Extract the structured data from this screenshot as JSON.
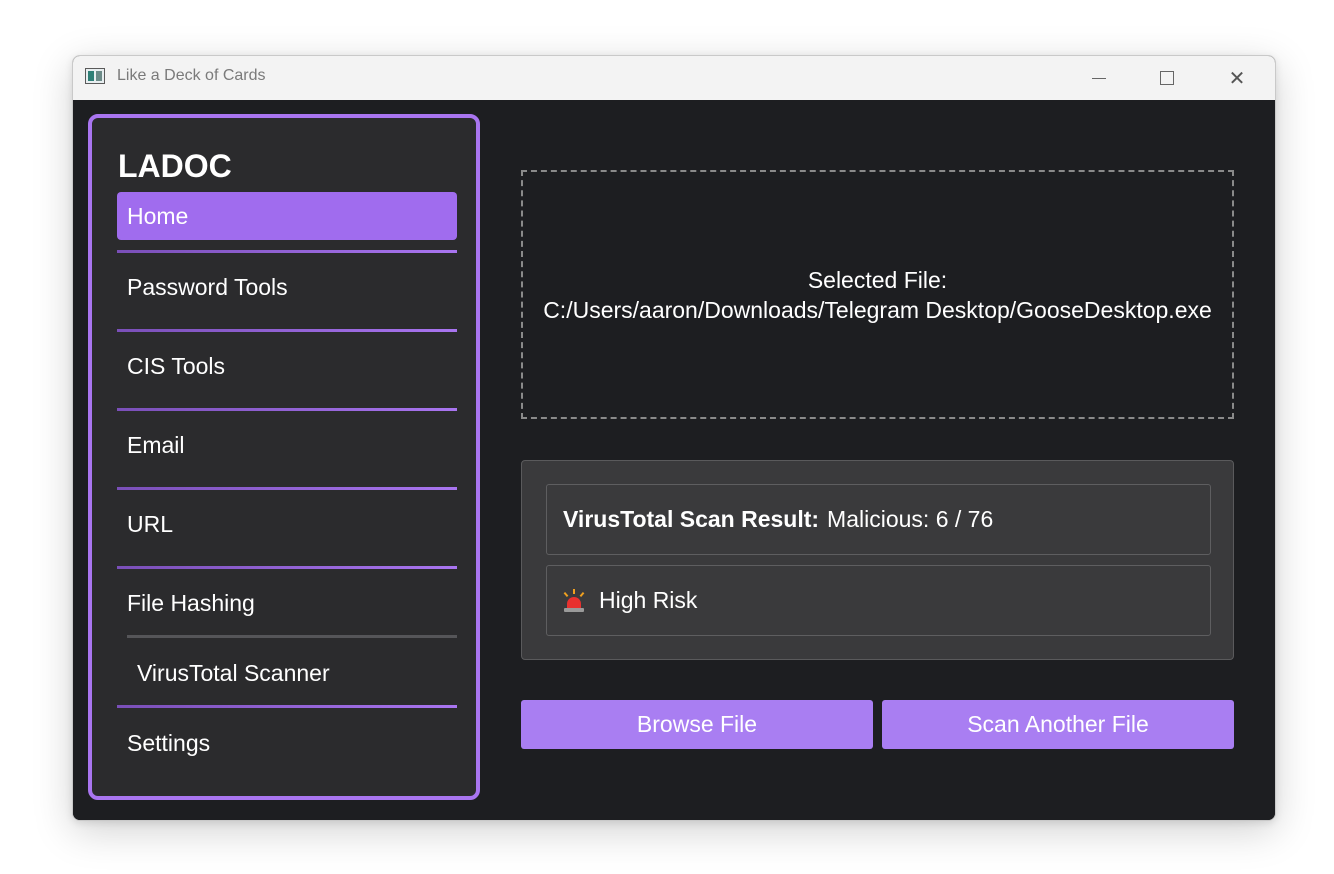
{
  "window": {
    "title": "Like a Deck of Cards"
  },
  "sidebar": {
    "brand": "LADOC",
    "items": [
      {
        "label": "Home"
      },
      {
        "label": "Password Tools"
      },
      {
        "label": "CIS Tools"
      },
      {
        "label": "Email"
      },
      {
        "label": "URL"
      },
      {
        "label": "File Hashing"
      },
      {
        "label": "VirusTotal Scanner"
      },
      {
        "label": "Settings"
      }
    ],
    "active": "Home"
  },
  "main": {
    "selected_file_label": "Selected File:",
    "selected_file_path": "C:/Users/aaron/Downloads/Telegram Desktop/GooseDesktop.exe",
    "scan_result_label": "VirusTotal Scan Result:",
    "scan_result_value": "Malicious: 6 / 76",
    "risk_icon": "siren-icon",
    "risk_text": "High Risk",
    "browse_button": "Browse File",
    "scan_another_button": "Scan Another File"
  },
  "colors": {
    "accent": "#a975f0",
    "background": "#1d1e21",
    "panel": "#2b2b2d"
  }
}
